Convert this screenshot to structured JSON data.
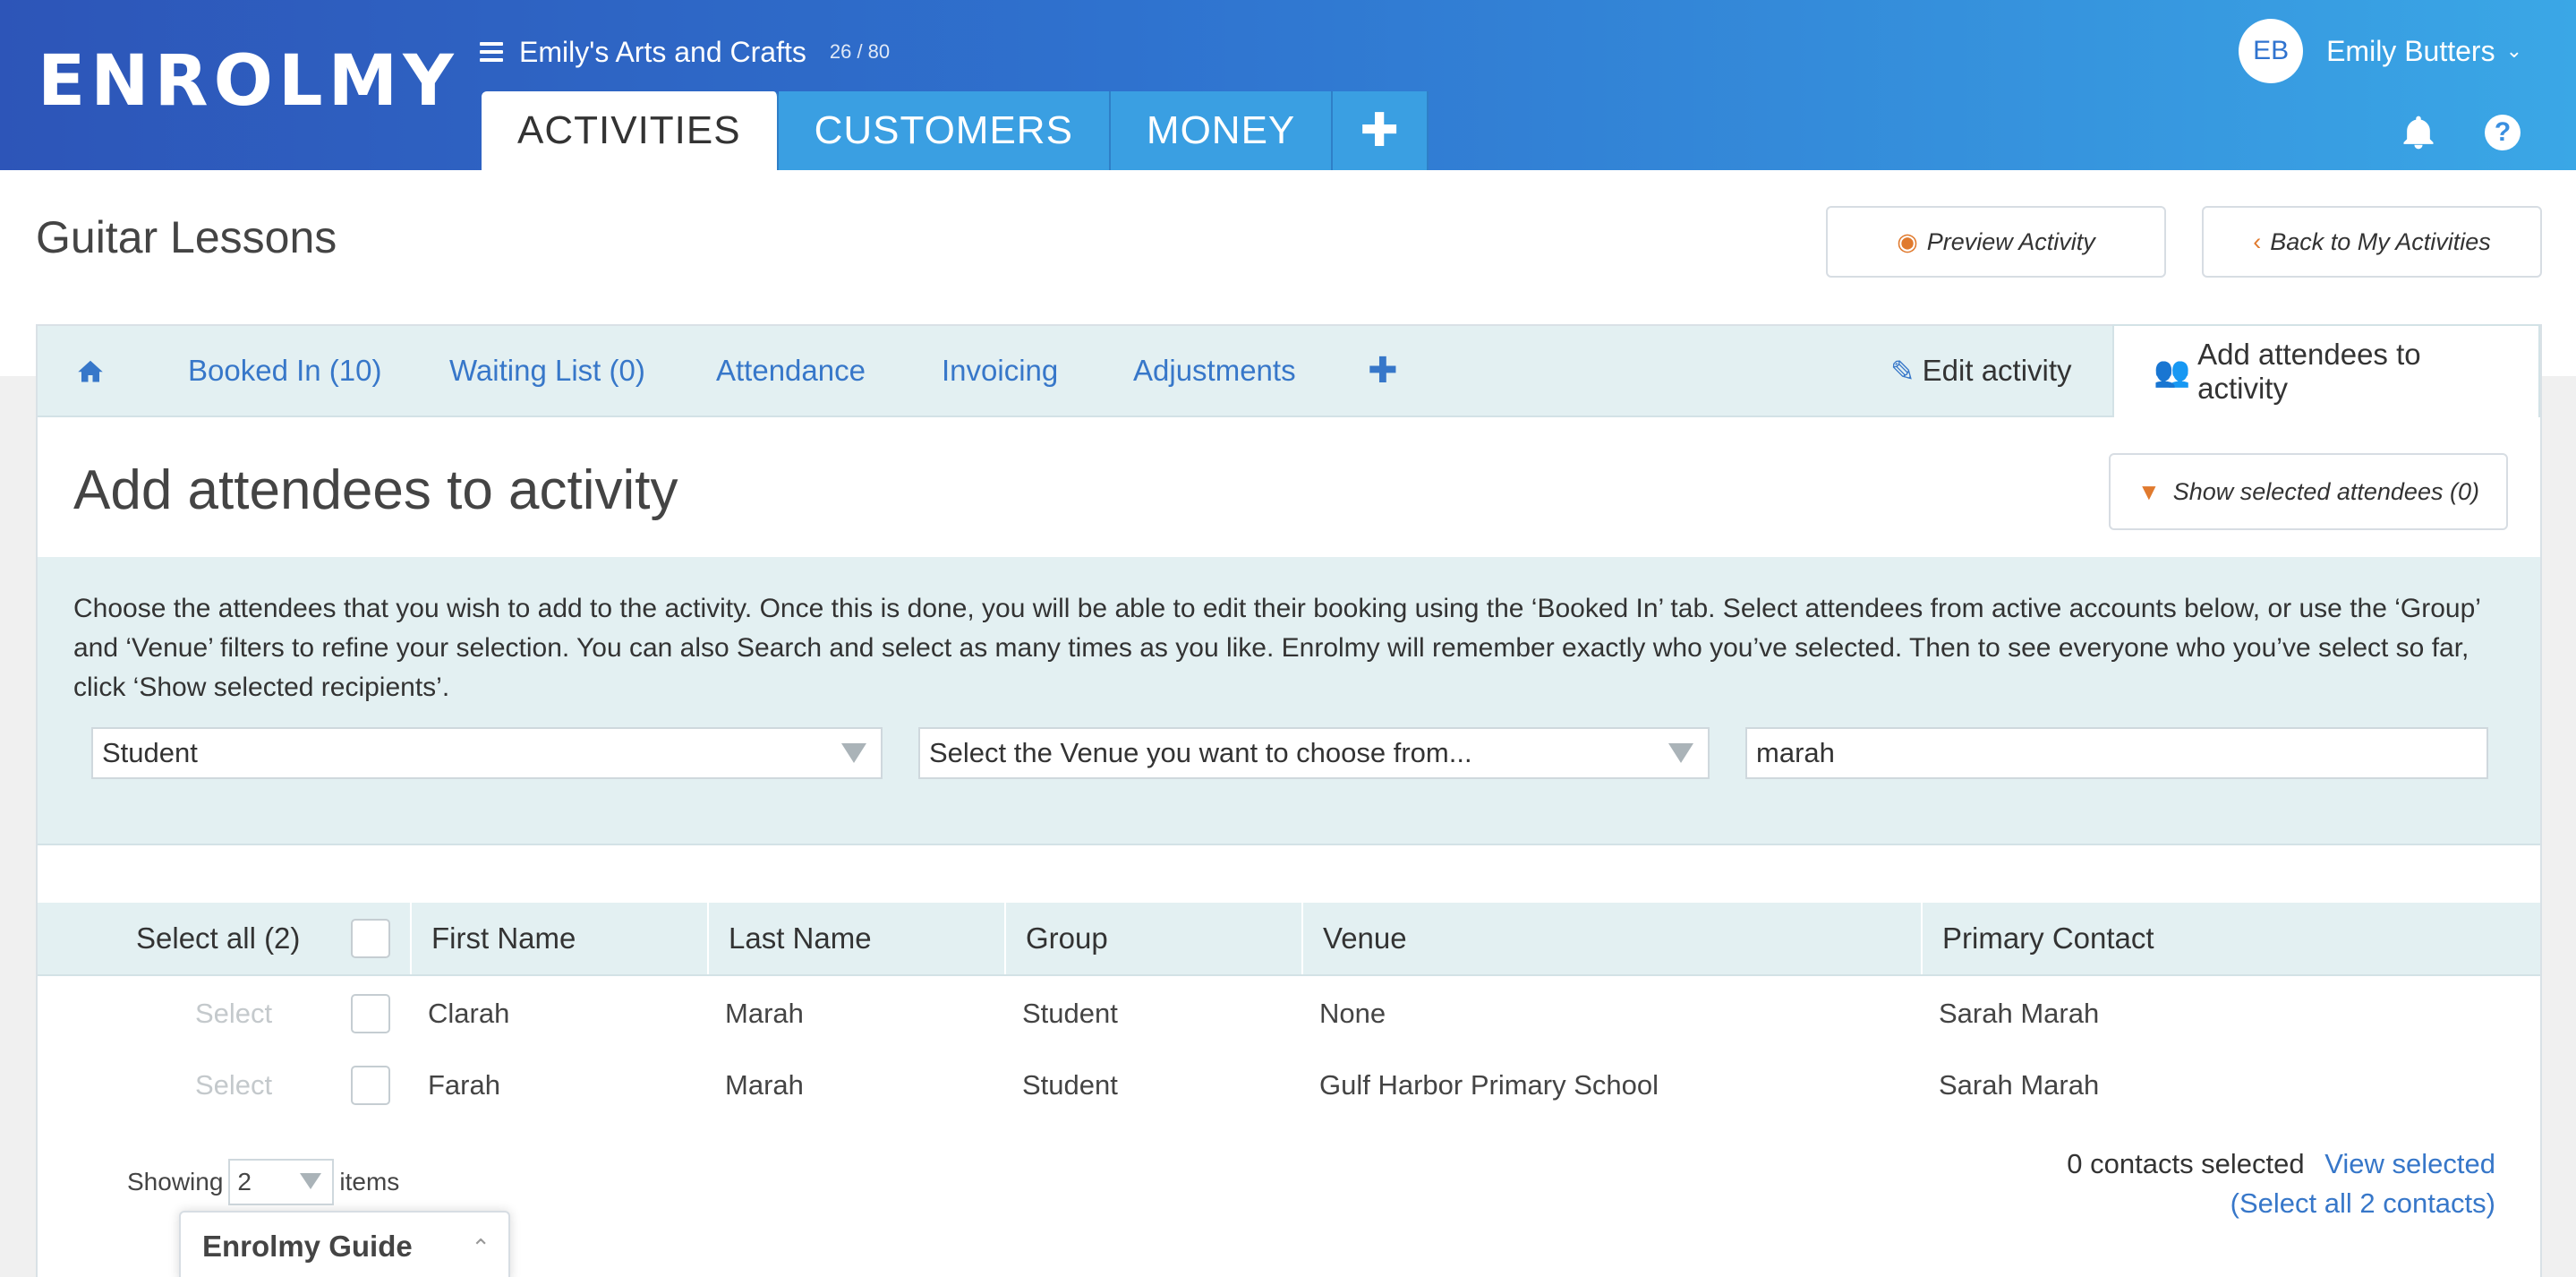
{
  "brand": {
    "logo": "ENROLMY"
  },
  "org": {
    "name": "Emily's Arts and Crafts",
    "count": "26 / 80"
  },
  "main_tabs": [
    "ACTIVITIES",
    "CUSTOMERS",
    "MONEY"
  ],
  "user": {
    "initials": "EB",
    "name": "Emily Butters"
  },
  "page": {
    "title": "Guitar Lessons",
    "preview_label": "Preview Activity",
    "back_label": "Back to My Activities"
  },
  "subnav": {
    "booked_in": "Booked In (10)",
    "waiting_list": "Waiting List (0)",
    "attendance": "Attendance",
    "invoicing": "Invoicing",
    "adjustments": "Adjustments",
    "edit_activity": "Edit activity",
    "add_attendees": "Add attendees to activity"
  },
  "section": {
    "title": "Add attendees to activity",
    "show_selected": "Show selected attendees (0)",
    "info": "Choose the attendees that you wish to add to the activity. Once this is done, you will be able to edit their booking using the ‘Booked In’ tab. Select attendees from active accounts below, or use the ‘Group’ and ‘Venue’ filters to refine your selection. You can also Search and select as many times as you like. Enrolmy will remember exactly who you’ve selected. Then to see everyone who you’ve select so far, click ‘Show selected recipients’."
  },
  "filters": {
    "group": "Student",
    "venue": "Select the Venue you want to choose from...",
    "search": "marah"
  },
  "table": {
    "select_all": "Select all (2)",
    "headers": [
      "First Name",
      "Last Name",
      "Group",
      "Venue",
      "Primary Contact"
    ],
    "select_label": "Select",
    "rows": [
      [
        "Clarah",
        "Marah",
        "Student",
        "None",
        "Sarah Marah"
      ],
      [
        "Farah",
        "Marah",
        "Student",
        "Gulf Harbor Primary School",
        "Sarah Marah"
      ]
    ]
  },
  "footer": {
    "showing": "Showing",
    "page_size": "2",
    "items": "items",
    "selected_count": "0 contacts selected",
    "view_selected": "View selected",
    "select_all_contacts": "(Select all 2 contacts)"
  },
  "guide": {
    "label": "Enrolmy Guide"
  },
  "colors": {
    "brand_blue": "#2f73cf",
    "accent_orange": "#e07a2e",
    "link_blue": "#3777c9",
    "panel_tint": "#e3f0f2"
  }
}
